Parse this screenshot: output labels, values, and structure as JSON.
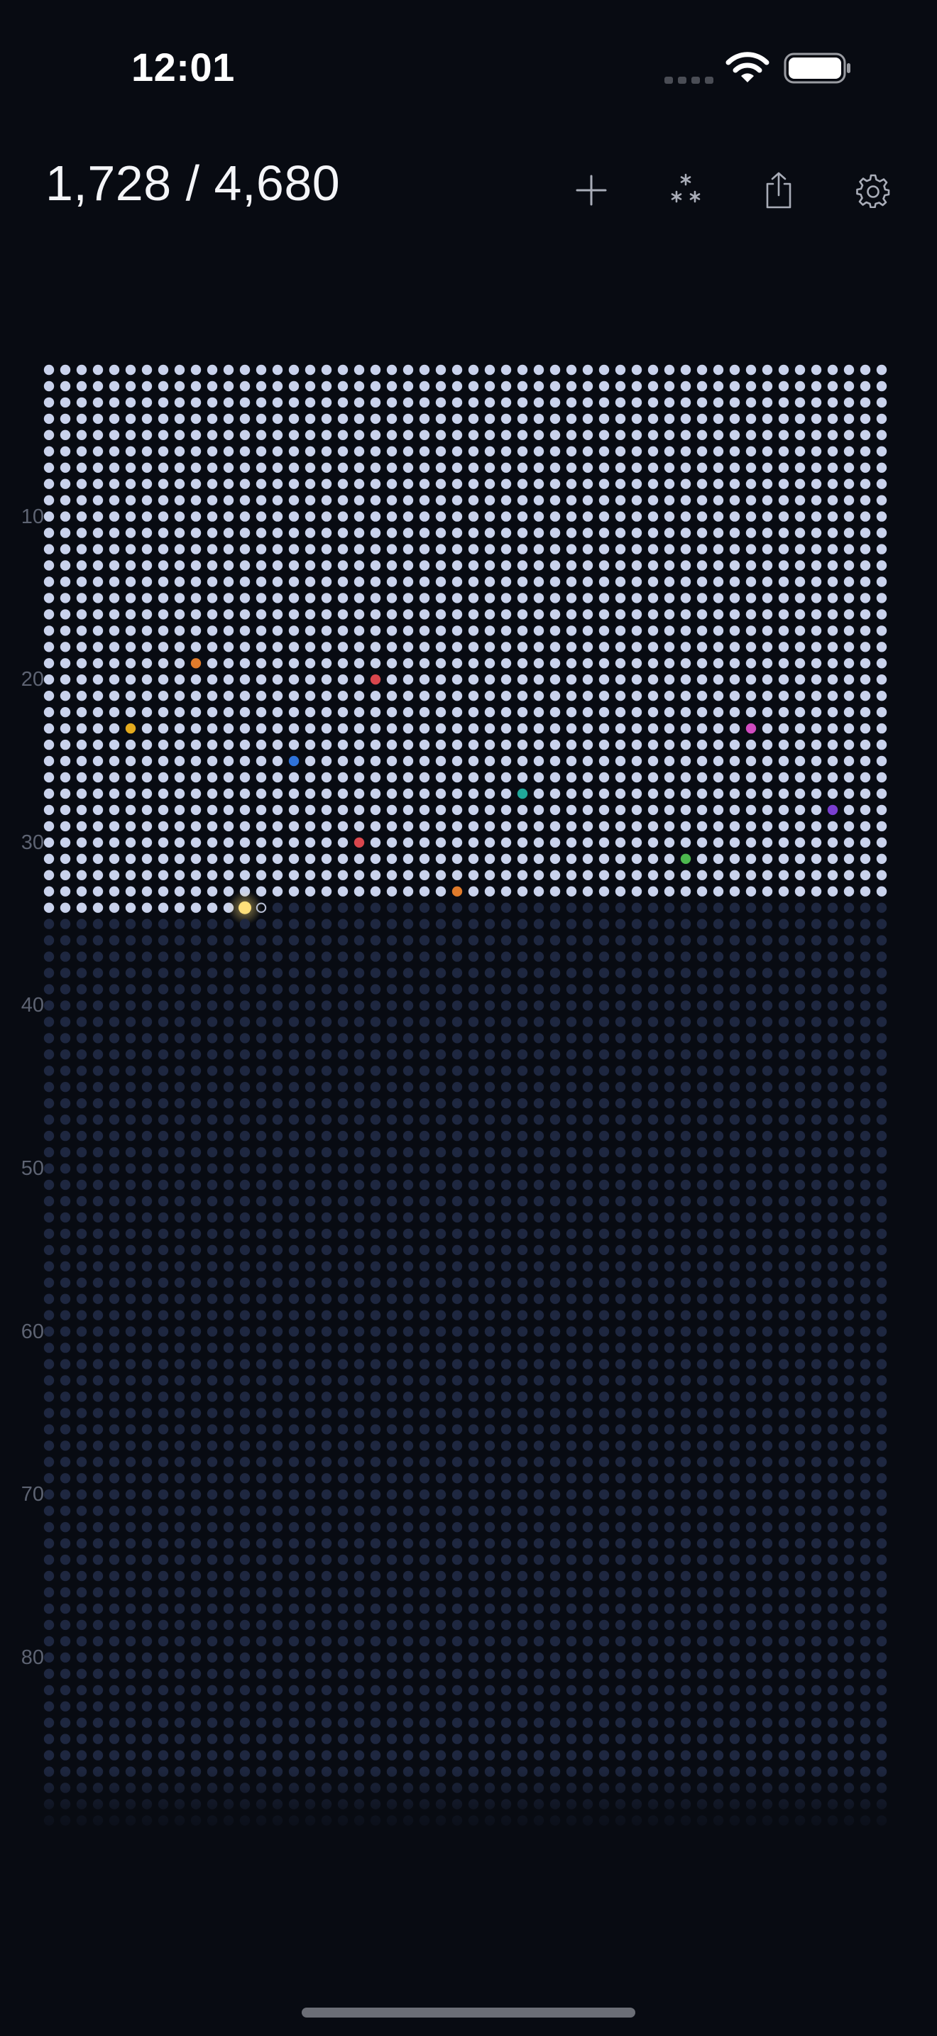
{
  "status_bar": {
    "time": "12:01",
    "icons": [
      "cellular-icon",
      "wifi-icon",
      "battery-icon"
    ]
  },
  "header": {
    "counter": "1,728 / 4,680",
    "actions": [
      {
        "name": "add-button",
        "icon": "plus-icon"
      },
      {
        "name": "sparkles-button",
        "icon": "sparkles-icon"
      },
      {
        "name": "share-button",
        "icon": "share-icon"
      },
      {
        "name": "settings-button",
        "icon": "gear-icon"
      }
    ]
  },
  "grid": {
    "columns": 52,
    "rows": 90,
    "filled_count": 1728,
    "total_count": 4680,
    "current_index": 1728,
    "row_labels": [
      "10",
      "20",
      "30",
      "40",
      "50",
      "60",
      "70",
      "80"
    ],
    "colors": {
      "filled": "#c9d2ec",
      "empty": "#1e2740",
      "current": "#ffe07a",
      "background": "#080b12"
    },
    "highlighted": [
      {
        "row": 19,
        "col": 10,
        "color": "#e07b2b"
      },
      {
        "row": 20,
        "col": 21,
        "color": "#d9464d"
      },
      {
        "row": 23,
        "col": 6,
        "color": "#e3aa1e"
      },
      {
        "row": 23,
        "col": 44,
        "color": "#d04cc0"
      },
      {
        "row": 25,
        "col": 16,
        "color": "#2f72d8"
      },
      {
        "row": 27,
        "col": 30,
        "color": "#20a79a"
      },
      {
        "row": 28,
        "col": 49,
        "color": "#7b3fd0"
      },
      {
        "row": 30,
        "col": 20,
        "color": "#d9464d"
      },
      {
        "row": 31,
        "col": 40,
        "color": "#4cb84e"
      },
      {
        "row": 33,
        "col": 26,
        "color": "#e07b2b"
      }
    ]
  }
}
